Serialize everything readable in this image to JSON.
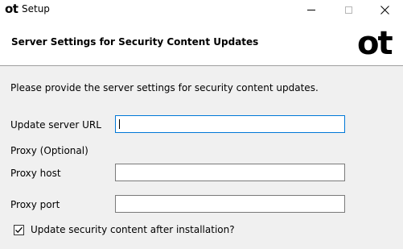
{
  "window": {
    "logo": "ot",
    "title": "Setup"
  },
  "header": {
    "title": "Server Settings for Security Content Updates",
    "logo": "ot"
  },
  "form": {
    "intro": "Please provide the server settings for security content updates.",
    "update_server_url": {
      "label": "Update server URL",
      "value": ""
    },
    "proxy_section_label": "Proxy (Optional)",
    "proxy_host": {
      "label": "Proxy host",
      "value": ""
    },
    "proxy_port": {
      "label": "Proxy port",
      "value": ""
    },
    "update_after_install": {
      "label": "Update security content after installation?",
      "checked": true
    }
  },
  "colors": {
    "focus_border": "#0078d7",
    "background": "#f0f0f0"
  }
}
